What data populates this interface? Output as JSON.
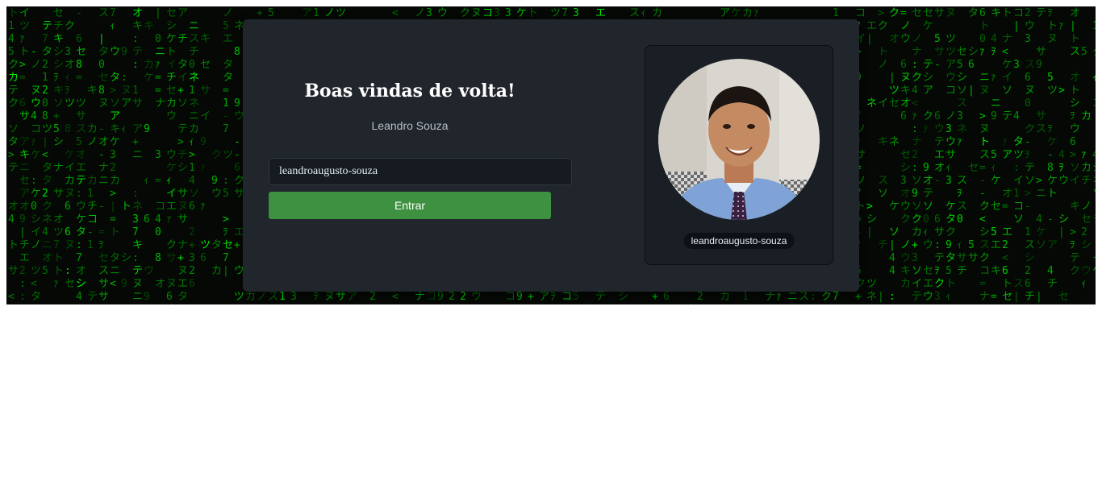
{
  "login": {
    "title": "Boas vindas de volta!",
    "name": "Leandro Souza",
    "username_value": "leandroaugusto-souza",
    "submit_label": "Entrar"
  },
  "profile": {
    "username": "leandroaugusto-souza"
  },
  "colors": {
    "background_rain": "#00c800",
    "card": "#21262d",
    "button": "#3d9140"
  }
}
